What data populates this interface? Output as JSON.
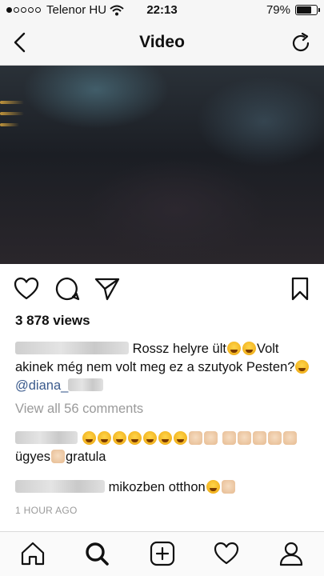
{
  "status_bar": {
    "carrier": "Telenor HU",
    "time": "22:13",
    "battery": "79%",
    "battery_level": 0.79,
    "signal_bars_filled": 1,
    "signal_bars_total": 5
  },
  "nav": {
    "title": "Video",
    "back_icon": "chevron-left-icon",
    "refresh_icon": "refresh-icon"
  },
  "post": {
    "views": "3 878 views",
    "caption": {
      "text_1": "Rossz helyre ült",
      "text_2": "Volt akinek még nem volt meg ez a szutyok Pesten?",
      "mention": "@diana_"
    },
    "view_all": "View all 56 comments",
    "comments": [
      {
        "text": "ügyes",
        "text_2": "gratula"
      },
      {
        "text": "mikozben otthon"
      }
    ],
    "time_ago": "1 HOUR AGO"
  },
  "actions": {
    "like_icon": "heart-icon",
    "comment_icon": "comment-icon",
    "share_icon": "send-icon",
    "save_icon": "bookmark-icon"
  },
  "tab_bar": {
    "items": [
      "home-icon",
      "search-icon",
      "add-icon",
      "activity-icon",
      "profile-icon"
    ],
    "active": "search-icon"
  },
  "colors": {
    "mention": "#3a5a8c",
    "muted": "#9a9a9a"
  }
}
